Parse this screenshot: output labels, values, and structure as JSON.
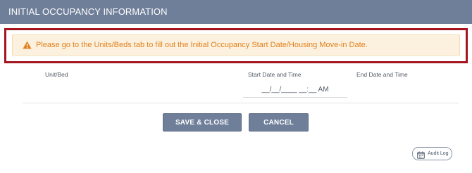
{
  "header": {
    "title": "INITIAL OCCUPANCY INFORMATION"
  },
  "alert": {
    "icon": "warning-icon",
    "message": "Please go to the Units/Beds tab to fill out the Initial Occupancy Start Date/Housing Move-in Date.",
    "color": "#e1801b",
    "frame_color": "#a3161f"
  },
  "columns": {
    "unit_bed": "Unit/Bed",
    "start_date_time": "Start Date and Time",
    "end_date_time": "End Date and Time"
  },
  "start_input": {
    "value": "__/__/____ __:__ AM"
  },
  "buttons": {
    "save_close": "SAVE & CLOSE",
    "cancel": "CANCEL",
    "color": "#6f7f99"
  },
  "audit_log": {
    "label": "Audit Log",
    "icon": "calendar-icon"
  }
}
